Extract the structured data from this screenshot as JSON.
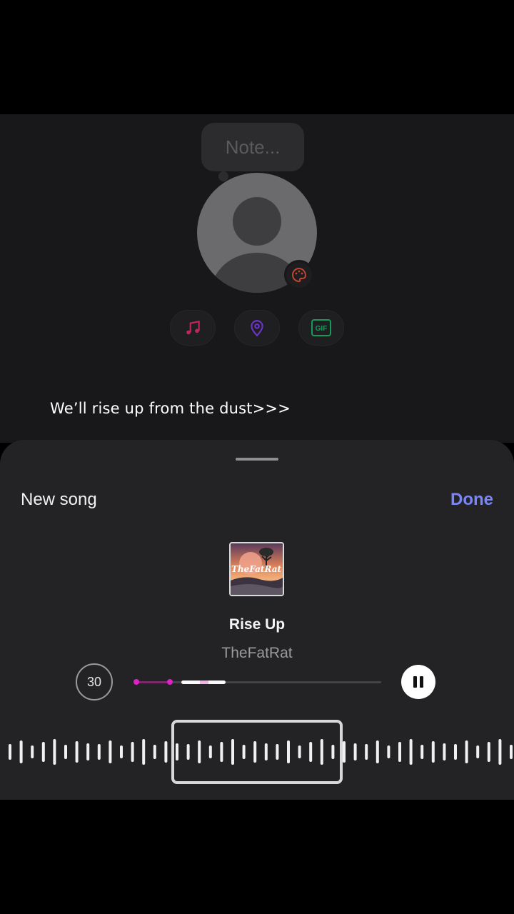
{
  "profile": {
    "note_placeholder": "Note...",
    "avatar_icon": "default-avatar-icon",
    "badge_icon": "palette-icon",
    "chips": [
      {
        "icon": "music-note-icon",
        "color": "#e0306a"
      },
      {
        "icon": "location-pin-icon",
        "color": "#7a3cd8"
      },
      {
        "icon": "gif-icon",
        "color": "#1fbf73",
        "label": "GIF"
      }
    ]
  },
  "lyric": "We’ll rise up from the dust>>>",
  "sheet": {
    "title": "New song",
    "done_label": "Done",
    "song": {
      "title": "Rise Up",
      "artist": "TheFatRat",
      "album_text": "TheFatRat"
    },
    "duration_label": "30",
    "progress_fraction": 0.36,
    "pause_icon": "pause-icon",
    "accent_color": "#7a86f8"
  }
}
